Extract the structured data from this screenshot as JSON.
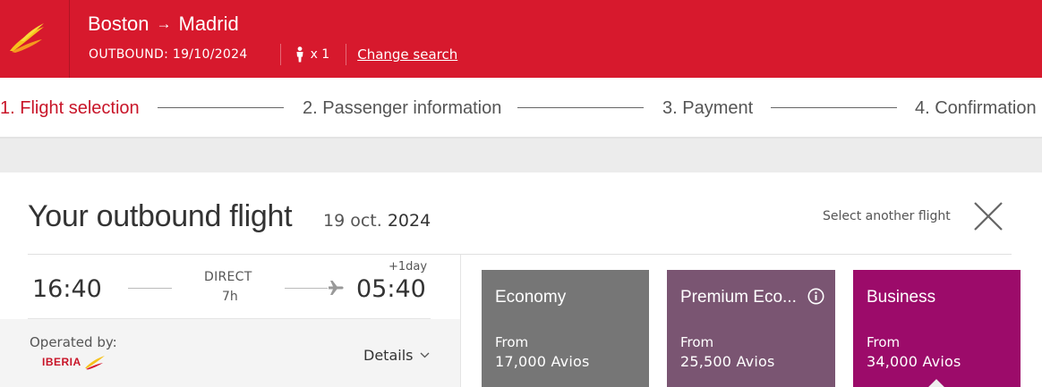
{
  "header": {
    "origin": "Boston",
    "arrow": "→",
    "destination": "Madrid",
    "outbound_label": "OUTBOUND: 19/10/2024",
    "passengers": "x 1",
    "change_search": "Change search"
  },
  "steps": [
    {
      "label": "1. Flight selection",
      "active": true
    },
    {
      "label": "2. Passenger information",
      "active": false
    },
    {
      "label": "3. Payment",
      "active": false
    },
    {
      "label": "4. Confirmation",
      "active": false
    }
  ],
  "flight": {
    "title": "Your outbound flight",
    "date_day": "19 oct.",
    "date_year": "2024",
    "select_another": "Select another flight",
    "departure": "16:40",
    "arrival": "05:40",
    "plus_day": "+1day",
    "stops": "DIRECT",
    "duration": "7h",
    "operated_by": "Operated by:",
    "operator": "IBERIA",
    "details": "Details"
  },
  "fares": [
    {
      "name": "Economy",
      "from": "From",
      "price": "17,000 Avios",
      "color": "#767676"
    },
    {
      "name": "Premium Eco...",
      "from": "From",
      "price": "25,500 Avios",
      "color": "#7a5572"
    },
    {
      "name": "Business",
      "from": "From",
      "price": "34,000 Avios",
      "color": "#9c0b6a"
    }
  ],
  "colors": {
    "brand_red": "#d7192d",
    "active_step": "#c81428"
  },
  "icons": {
    "logo": "iberia-logo-icon",
    "passenger": "person-icon",
    "close": "close-icon",
    "plane": "plane-icon",
    "info": "info-icon",
    "chevron": "chevron-down-icon"
  }
}
